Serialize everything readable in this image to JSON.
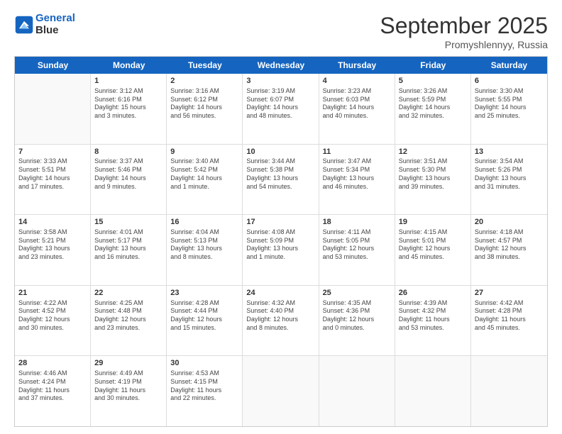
{
  "header": {
    "logo_line1": "General",
    "logo_line2": "Blue",
    "month_title": "September 2025",
    "subtitle": "Promyshlennyy, Russia"
  },
  "weekdays": [
    "Sunday",
    "Monday",
    "Tuesday",
    "Wednesday",
    "Thursday",
    "Friday",
    "Saturday"
  ],
  "rows": [
    [
      {
        "day": "",
        "info": ""
      },
      {
        "day": "1",
        "info": "Sunrise: 3:12 AM\nSunset: 6:16 PM\nDaylight: 15 hours\nand 3 minutes."
      },
      {
        "day": "2",
        "info": "Sunrise: 3:16 AM\nSunset: 6:12 PM\nDaylight: 14 hours\nand 56 minutes."
      },
      {
        "day": "3",
        "info": "Sunrise: 3:19 AM\nSunset: 6:07 PM\nDaylight: 14 hours\nand 48 minutes."
      },
      {
        "day": "4",
        "info": "Sunrise: 3:23 AM\nSunset: 6:03 PM\nDaylight: 14 hours\nand 40 minutes."
      },
      {
        "day": "5",
        "info": "Sunrise: 3:26 AM\nSunset: 5:59 PM\nDaylight: 14 hours\nand 32 minutes."
      },
      {
        "day": "6",
        "info": "Sunrise: 3:30 AM\nSunset: 5:55 PM\nDaylight: 14 hours\nand 25 minutes."
      }
    ],
    [
      {
        "day": "7",
        "info": "Sunrise: 3:33 AM\nSunset: 5:51 PM\nDaylight: 14 hours\nand 17 minutes."
      },
      {
        "day": "8",
        "info": "Sunrise: 3:37 AM\nSunset: 5:46 PM\nDaylight: 14 hours\nand 9 minutes."
      },
      {
        "day": "9",
        "info": "Sunrise: 3:40 AM\nSunset: 5:42 PM\nDaylight: 14 hours\nand 1 minute."
      },
      {
        "day": "10",
        "info": "Sunrise: 3:44 AM\nSunset: 5:38 PM\nDaylight: 13 hours\nand 54 minutes."
      },
      {
        "day": "11",
        "info": "Sunrise: 3:47 AM\nSunset: 5:34 PM\nDaylight: 13 hours\nand 46 minutes."
      },
      {
        "day": "12",
        "info": "Sunrise: 3:51 AM\nSunset: 5:30 PM\nDaylight: 13 hours\nand 39 minutes."
      },
      {
        "day": "13",
        "info": "Sunrise: 3:54 AM\nSunset: 5:26 PM\nDaylight: 13 hours\nand 31 minutes."
      }
    ],
    [
      {
        "day": "14",
        "info": "Sunrise: 3:58 AM\nSunset: 5:21 PM\nDaylight: 13 hours\nand 23 minutes."
      },
      {
        "day": "15",
        "info": "Sunrise: 4:01 AM\nSunset: 5:17 PM\nDaylight: 13 hours\nand 16 minutes."
      },
      {
        "day": "16",
        "info": "Sunrise: 4:04 AM\nSunset: 5:13 PM\nDaylight: 13 hours\nand 8 minutes."
      },
      {
        "day": "17",
        "info": "Sunrise: 4:08 AM\nSunset: 5:09 PM\nDaylight: 13 hours\nand 1 minute."
      },
      {
        "day": "18",
        "info": "Sunrise: 4:11 AM\nSunset: 5:05 PM\nDaylight: 12 hours\nand 53 minutes."
      },
      {
        "day": "19",
        "info": "Sunrise: 4:15 AM\nSunset: 5:01 PM\nDaylight: 12 hours\nand 45 minutes."
      },
      {
        "day": "20",
        "info": "Sunrise: 4:18 AM\nSunset: 4:57 PM\nDaylight: 12 hours\nand 38 minutes."
      }
    ],
    [
      {
        "day": "21",
        "info": "Sunrise: 4:22 AM\nSunset: 4:52 PM\nDaylight: 12 hours\nand 30 minutes."
      },
      {
        "day": "22",
        "info": "Sunrise: 4:25 AM\nSunset: 4:48 PM\nDaylight: 12 hours\nand 23 minutes."
      },
      {
        "day": "23",
        "info": "Sunrise: 4:28 AM\nSunset: 4:44 PM\nDaylight: 12 hours\nand 15 minutes."
      },
      {
        "day": "24",
        "info": "Sunrise: 4:32 AM\nSunset: 4:40 PM\nDaylight: 12 hours\nand 8 minutes."
      },
      {
        "day": "25",
        "info": "Sunrise: 4:35 AM\nSunset: 4:36 PM\nDaylight: 12 hours\nand 0 minutes."
      },
      {
        "day": "26",
        "info": "Sunrise: 4:39 AM\nSunset: 4:32 PM\nDaylight: 11 hours\nand 53 minutes."
      },
      {
        "day": "27",
        "info": "Sunrise: 4:42 AM\nSunset: 4:28 PM\nDaylight: 11 hours\nand 45 minutes."
      }
    ],
    [
      {
        "day": "28",
        "info": "Sunrise: 4:46 AM\nSunset: 4:24 PM\nDaylight: 11 hours\nand 37 minutes."
      },
      {
        "day": "29",
        "info": "Sunrise: 4:49 AM\nSunset: 4:19 PM\nDaylight: 11 hours\nand 30 minutes."
      },
      {
        "day": "30",
        "info": "Sunrise: 4:53 AM\nSunset: 4:15 PM\nDaylight: 11 hours\nand 22 minutes."
      },
      {
        "day": "",
        "info": ""
      },
      {
        "day": "",
        "info": ""
      },
      {
        "day": "",
        "info": ""
      },
      {
        "day": "",
        "info": ""
      }
    ]
  ]
}
